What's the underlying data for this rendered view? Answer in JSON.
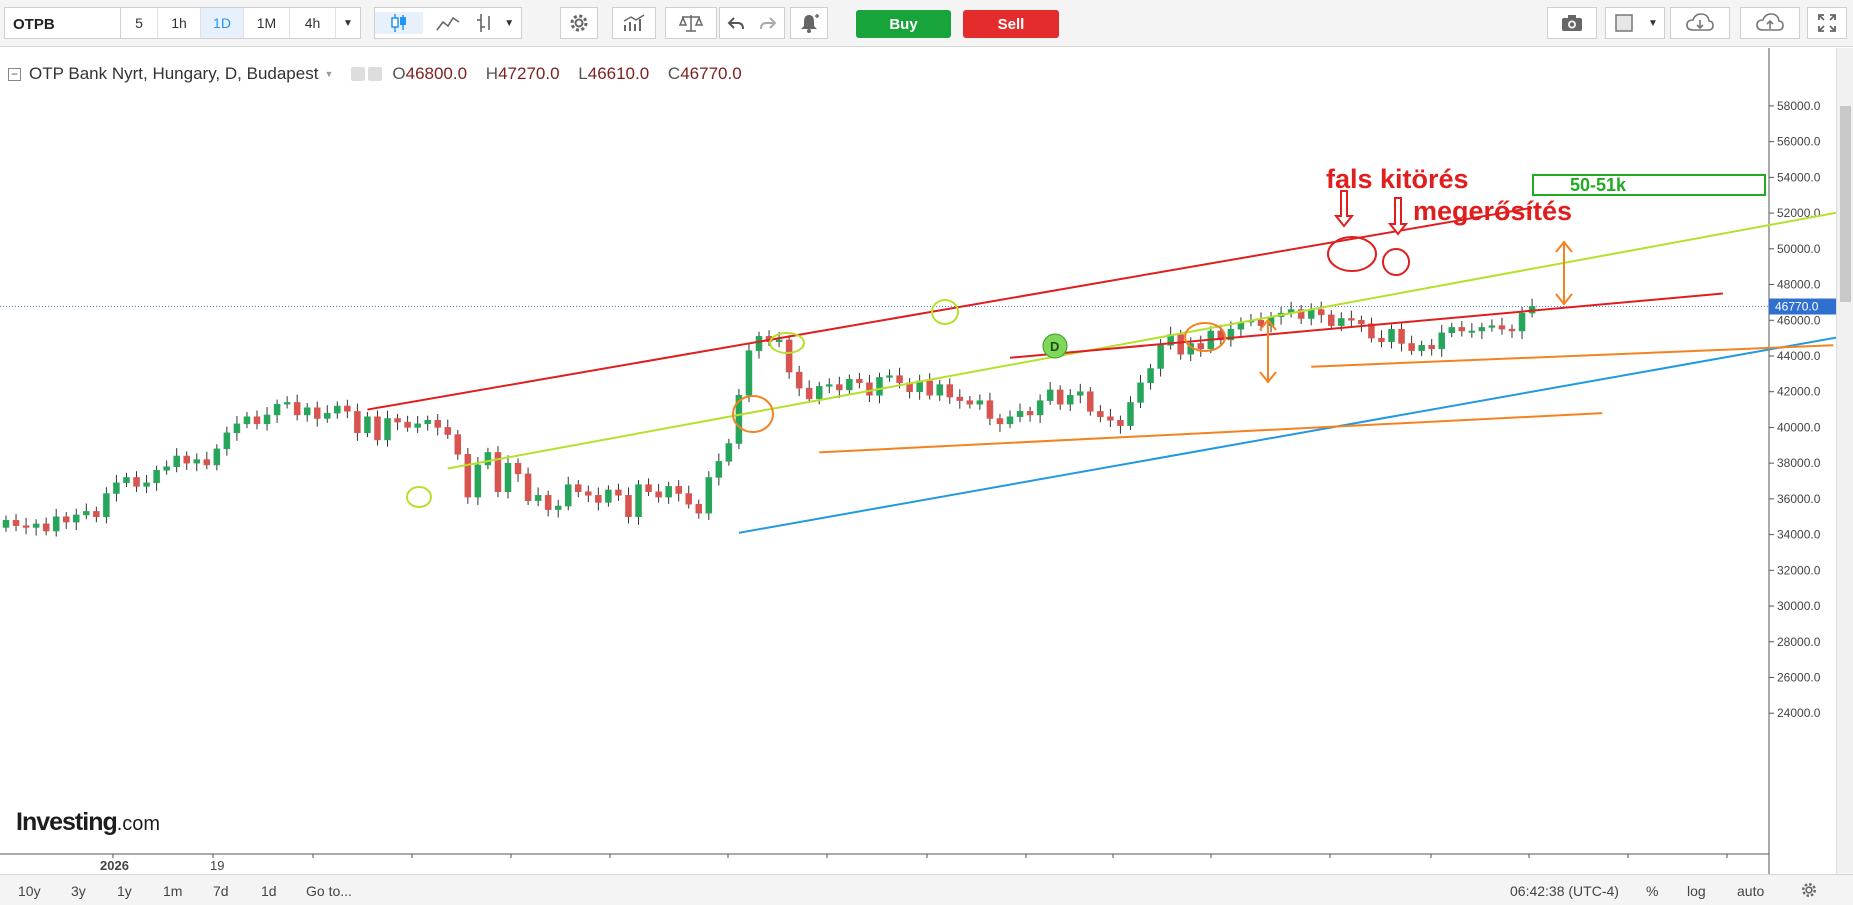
{
  "toolbar": {
    "symbol": "OTPB",
    "timeframes": [
      {
        "label": "5",
        "active": false
      },
      {
        "label": "1h",
        "active": false
      },
      {
        "label": "1D",
        "active": true
      },
      {
        "label": "1M",
        "active": false
      },
      {
        "label": "4h",
        "active": false
      }
    ],
    "buy_label": "Buy",
    "sell_label": "Sell",
    "icons": [
      "candles-icon",
      "line-chart-icon",
      "bars-icon",
      "gear-icon",
      "indicators-icon",
      "compare-icon",
      "undo-icon",
      "redo-icon",
      "alert-icon",
      "camera-icon",
      "color-square-icon",
      "cloud-download-icon",
      "cloud-upload-icon",
      "fullscreen-icon"
    ]
  },
  "legend": {
    "title": "OTP Bank Nyrt, Hungary, D, Budapest",
    "collapse": "−",
    "o_label": "O",
    "o_value": "46800.0",
    "h_label": "H",
    "h_value": "47270.0",
    "l_label": "L",
    "l_value": "46610.0",
    "c_label": "C",
    "c_value": "46770.0"
  },
  "chart_data": {
    "type": "candlestick",
    "title": "OTP Bank Nyrt, Hungary, D, Budapest",
    "ylim": [
      22500,
      58500
    ],
    "y_ticks": [
      "58000.0",
      "56000.0",
      "54000.0",
      "52000.0",
      "50000.0",
      "48000.0",
      "46000.0",
      "44000.0",
      "42000.0",
      "40000.0",
      "38000.0",
      "36000.0",
      "34000.0",
      "32000.0",
      "30000.0",
      "28000.0",
      "26000.0",
      "24000.0"
    ],
    "x_tick_labels": [
      "2026",
      "19"
    ],
    "last_price": 46770,
    "last_price_label": "46770.0",
    "grid": false,
    "candles_close": [
      34800,
      34500,
      34400,
      34600,
      34200,
      35000,
      34700,
      35100,
      35300,
      35000,
      36300,
      36900,
      37200,
      36700,
      36900,
      37600,
      37800,
      38400,
      38000,
      38200,
      37900,
      38800,
      39700,
      40200,
      40600,
      40200,
      40700,
      41300,
      41400,
      40700,
      41100,
      40500,
      40800,
      41200,
      40900,
      39700,
      40600,
      39300,
      40500,
      40300,
      40000,
      40200,
      40400,
      40000,
      39600,
      38500,
      36100,
      37900,
      38600,
      36400,
      38000,
      37400,
      35900,
      36200,
      35400,
      35600,
      36800,
      36400,
      36200,
      35800,
      36500,
      36200,
      35000,
      36800,
      36400,
      36100,
      36700,
      36300,
      35700,
      35200,
      37200,
      38100,
      39100,
      41800,
      44300,
      45100,
      44800,
      44900,
      43100,
      42200,
      41600,
      42300,
      42400,
      42100,
      42700,
      42500,
      41800,
      42800,
      42900,
      42500,
      42000,
      42600,
      41800,
      42400,
      41700,
      41500,
      41300,
      41500,
      40500,
      40200,
      40600,
      40900,
      40700,
      41500,
      42100,
      41300,
      41800,
      42000,
      40900,
      40600,
      40400,
      40100,
      41400,
      42500,
      43300,
      44600,
      45200,
      44100,
      44700,
      44400,
      45400,
      44900,
      45500,
      45900,
      46000,
      45700,
      46200,
      46400,
      46600,
      46100,
      46600,
      46300,
      45700,
      46100,
      46000,
      45800,
      45000,
      44800,
      45500,
      44700,
      44300,
      44600,
      44400,
      45300,
      45600,
      45400,
      45400,
      45600,
      45700,
      45500,
      45400,
      46400,
      46770
    ],
    "annotations": {
      "texts": [
        {
          "text": "fals kitörés",
          "color": "#e01e1e"
        },
        {
          "text": "megerősítés",
          "color": "#e01e1e"
        },
        {
          "text": "50-51k",
          "color": "#22aa22"
        }
      ],
      "trendlines": [
        {
          "color": "#e01e1e",
          "from": {
            "i": 36,
            "y": 41000
          },
          "to": {
            "i": 152,
            "y": 52300
          }
        },
        {
          "color": "#b5e02b",
          "from": {
            "i": 44,
            "y": 37700
          },
          "to": {
            "i": 185,
            "y": 52300
          }
        },
        {
          "color": "#e01e1e",
          "from": {
            "i": 100,
            "y": 43900
          },
          "to": {
            "i": 171,
            "y": 47500
          }
        },
        {
          "color": "#1f9ae0",
          "from": {
            "i": 73,
            "y": 34100
          },
          "to": {
            "i": 193,
            "y": 46100
          }
        },
        {
          "color": "#f58220",
          "from": {
            "i": 81,
            "y": 38600
          },
          "to": {
            "i": 159,
            "y": 40800
          }
        },
        {
          "color": "#f58220",
          "from": {
            "i": 130,
            "y": 43400
          },
          "to": {
            "i": 182,
            "y": 44600
          }
        }
      ]
    }
  },
  "logo": {
    "brand": "Investing",
    "suffix": ".com"
  },
  "bottombar": {
    "ranges": [
      "10y",
      "3y",
      "1y",
      "1m",
      "7d",
      "1d",
      "Go to..."
    ],
    "time": "06:42:38 (UTC-4)",
    "percent": "%",
    "log": "log",
    "auto": "auto"
  }
}
